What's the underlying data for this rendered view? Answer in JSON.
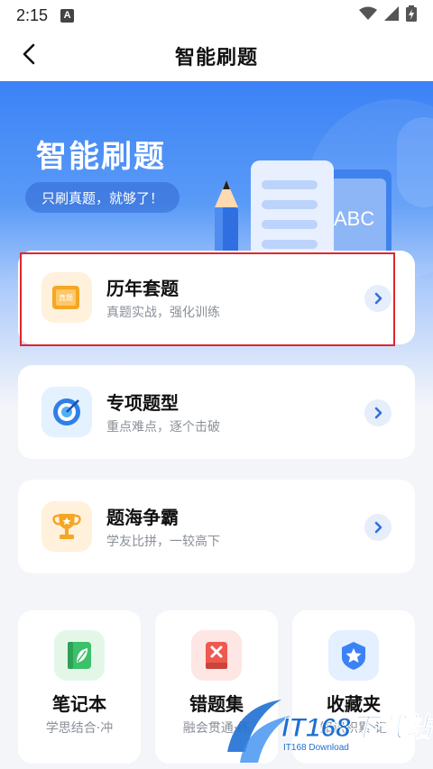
{
  "status_bar": {
    "time": "2:15",
    "notification_badge": "A",
    "icons": [
      "wifi-icon",
      "signal-icon",
      "battery-charging-icon"
    ]
  },
  "nav": {
    "title": "智能刷题",
    "back_icon": "chevron-left-icon"
  },
  "hero": {
    "title": "智能刷题",
    "subtitle": "只刷真题，就够了！",
    "illustration_text": "ABC",
    "illustration_icons": [
      "pencil-icon",
      "paper-scroll-icon",
      "book-icon"
    ]
  },
  "cards": [
    {
      "title": "历年套题",
      "subtitle": "真题实战，强化训练",
      "icon": "exam-scroll-icon",
      "icon_text": "真题",
      "highlighted": true
    },
    {
      "title": "专项题型",
      "subtitle": "重点难点，逐个击破",
      "icon": "target-icon",
      "highlighted": false
    },
    {
      "title": "题海争霸",
      "subtitle": "学友比拼，一较高下",
      "icon": "trophy-icon",
      "highlighted": false
    }
  ],
  "tiles": [
    {
      "title": "笔记本",
      "subtitle": "学思结合·冲",
      "icon": "notebook-leaf-icon"
    },
    {
      "title": "错题集",
      "subtitle": "融会贯通·练",
      "icon": "wrong-book-icon"
    },
    {
      "title": "收藏夹",
      "subtitle": "知识积累·记",
      "icon": "star-shield-icon"
    }
  ],
  "watermark": {
    "main": "IT168下载站",
    "sub": "IT168 Download"
  },
  "colors": {
    "primary": "#3b82f6",
    "highlight_border": "#e0262b",
    "arrow_bg": "#e6eefc",
    "page_bg": "#f3f5f9"
  }
}
